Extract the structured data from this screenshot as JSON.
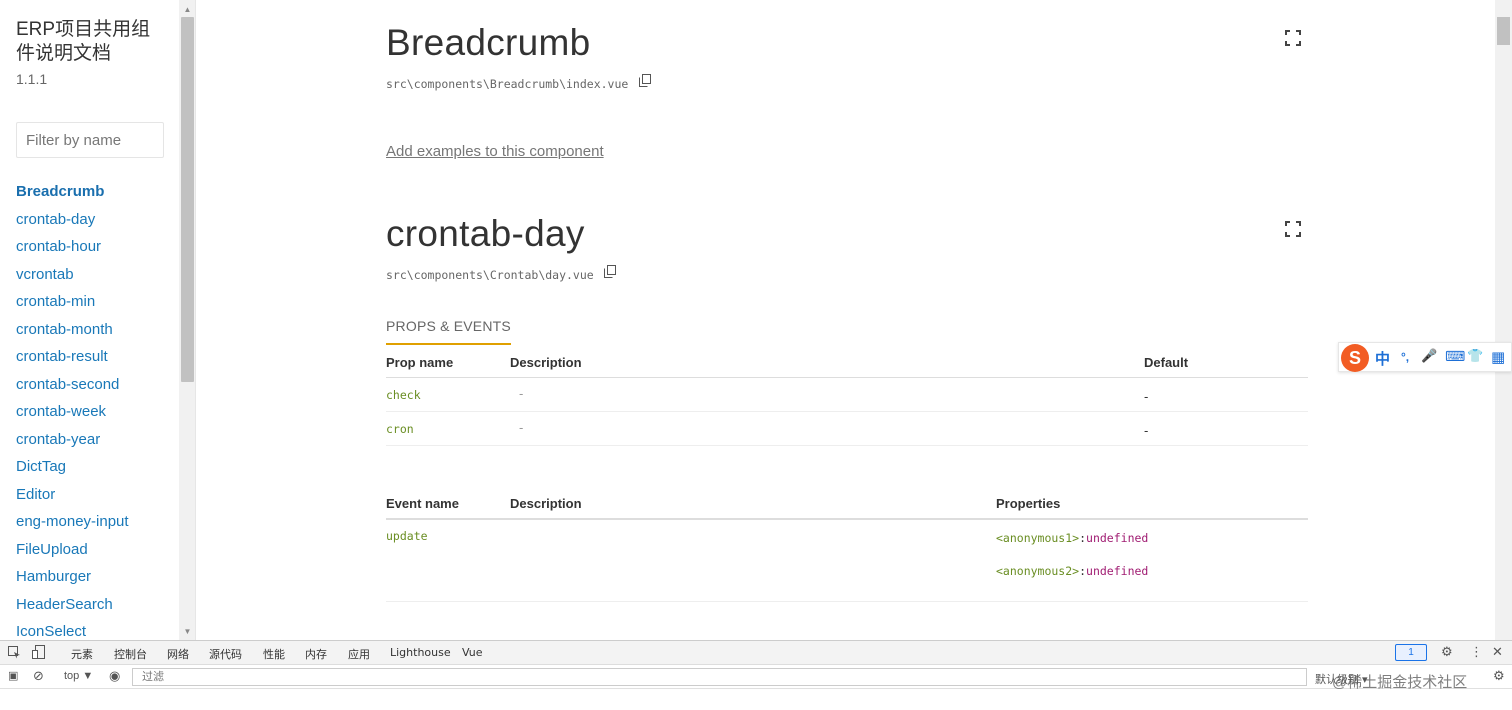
{
  "sidebar": {
    "title": "ERP项目共用组件说明文档",
    "version": "1.1.1",
    "filter_placeholder": "Filter by name",
    "items": [
      {
        "label": "Breadcrumb",
        "active": true
      },
      {
        "label": "crontab-day"
      },
      {
        "label": "crontab-hour"
      },
      {
        "label": "vcrontab"
      },
      {
        "label": "crontab-min"
      },
      {
        "label": "crontab-month"
      },
      {
        "label": "crontab-result"
      },
      {
        "label": "crontab-second"
      },
      {
        "label": "crontab-week"
      },
      {
        "label": "crontab-year"
      },
      {
        "label": "DictTag"
      },
      {
        "label": "Editor"
      },
      {
        "label": "eng-money-input"
      },
      {
        "label": "FileUpload"
      },
      {
        "label": "Hamburger"
      },
      {
        "label": "HeaderSearch"
      },
      {
        "label": "IconSelect"
      }
    ]
  },
  "main": {
    "breadcrumb_section": {
      "title": "Breadcrumb",
      "path": "src\\components\\Breadcrumb\\index.vue",
      "add_examples_link": "Add examples to this component"
    },
    "crontab_section": {
      "title": "crontab-day",
      "path": "src\\components\\Crontab\\day.vue",
      "tab_label": "PROPS & EVENTS",
      "props_table": {
        "headers": [
          "Prop name",
          "Description",
          "Default"
        ],
        "rows": [
          {
            "name": "check",
            "description": "-",
            "default": "-"
          },
          {
            "name": "cron",
            "description": "-",
            "default": "-"
          }
        ]
      },
      "events_table": {
        "headers": [
          "Event name",
          "Description",
          "Properties"
        ],
        "rows": [
          {
            "name": "update",
            "description": "",
            "properties": [
              {
                "name": "<anonymous1>",
                "type": "undefined"
              },
              {
                "name": "<anonymous2>",
                "type": "undefined"
              }
            ]
          }
        ]
      }
    }
  },
  "ime_toolbar": {
    "logo": "S",
    "items": [
      "中",
      "°,",
      "🎤",
      "⌨",
      "👕",
      "▦"
    ]
  },
  "devtools": {
    "tabs": [
      "元素",
      "控制台",
      "网络",
      "源代码",
      "性能",
      "内存",
      "应用",
      "Lighthouse",
      "Vue"
    ],
    "active_tab": "控制台",
    "context_select": "top ▼",
    "filter_placeholder": "过滤",
    "issues_badge": "1",
    "levels_label": "默认级别 ▾",
    "watermark": "@稀土掘金技术社区"
  },
  "colors": {
    "link": "#1978b8",
    "code_green": "#6a8e23",
    "type_purple": "#a01c72",
    "tab_underline": "#e0a000",
    "ime_orange": "#f25c23",
    "ime_blue": "#1d6fd6"
  }
}
